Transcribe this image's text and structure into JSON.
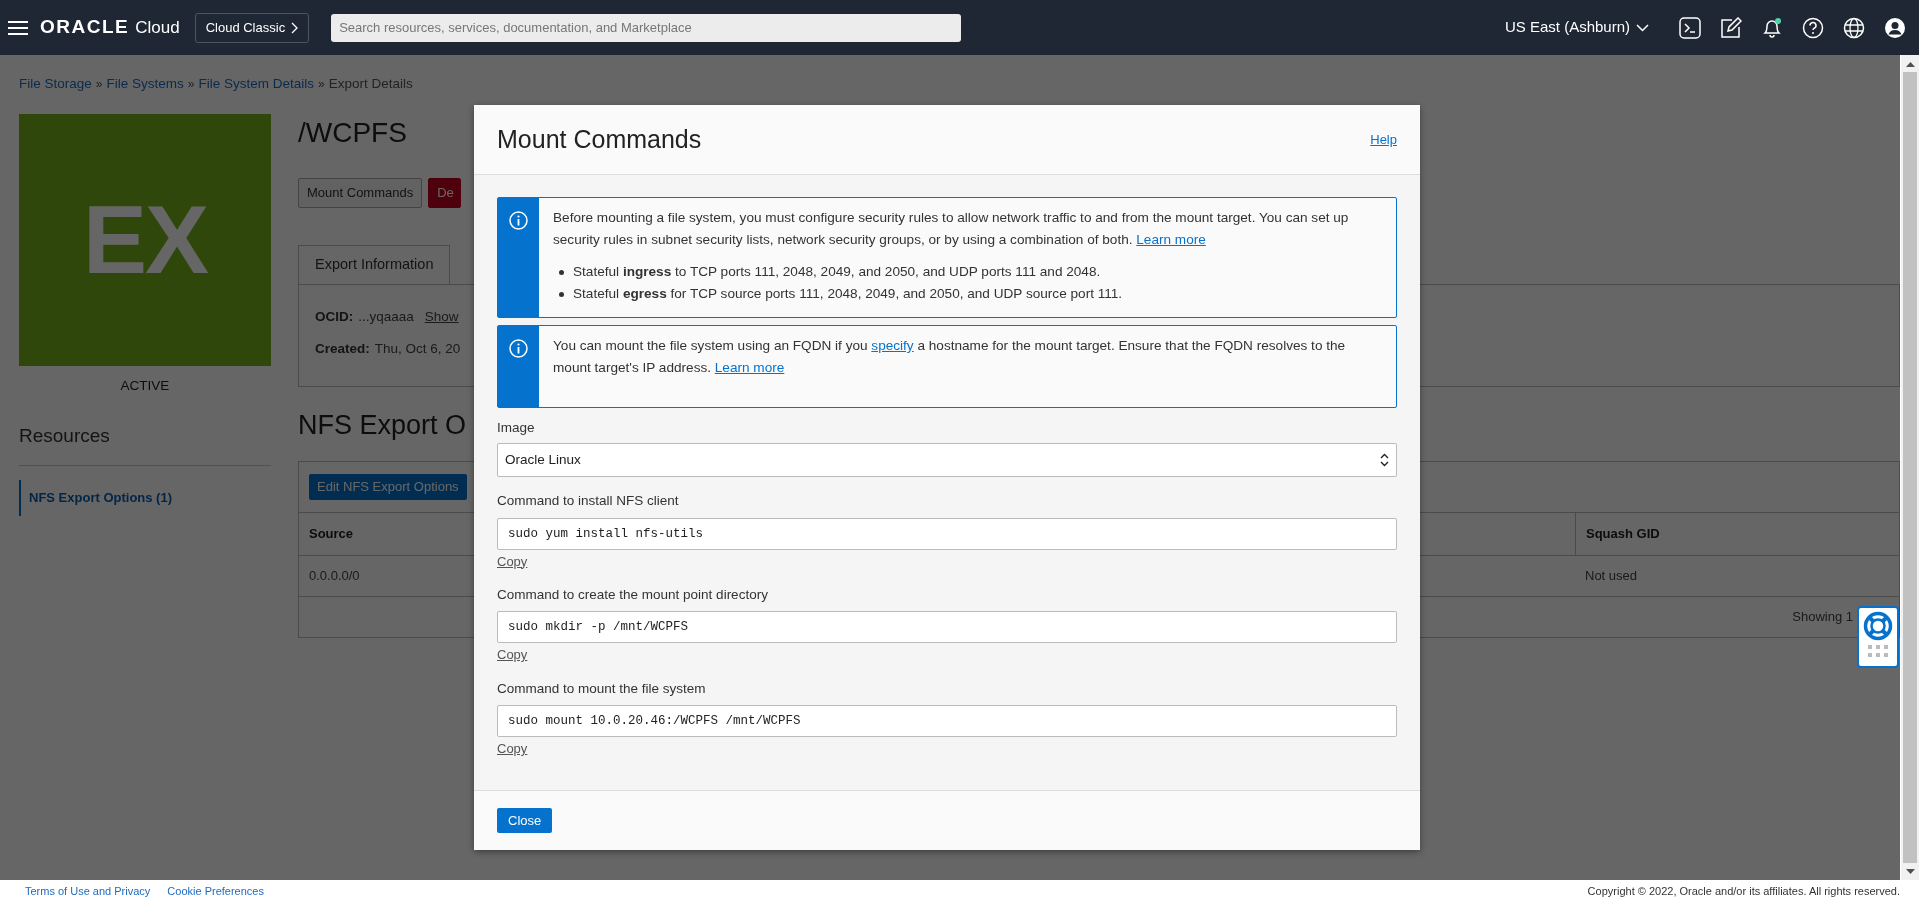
{
  "top_bar": {
    "wordmark": "ORACLE",
    "product": "Cloud",
    "console_button": "Cloud Classic",
    "search": {
      "placeholder": "Search resources, services, documentation, and Marketplace"
    },
    "region": "US East (Ashburn)"
  },
  "breadcrumb": {
    "separator": "»",
    "items": [
      {
        "label": "File Storage",
        "current": false
      },
      {
        "label": "File Systems",
        "current": false
      },
      {
        "label": "File System Details",
        "current": false
      },
      {
        "label": "Export Details",
        "current": true
      }
    ]
  },
  "resource": {
    "badge": "EX",
    "state": "ACTIVE",
    "title": "/WCPFS",
    "buttons": [
      {
        "label": "Mount Commands",
        "kind": "default"
      },
      {
        "label": "De",
        "kind": "danger"
      }
    ]
  },
  "sidebar": {
    "title": "Resources",
    "items": [
      {
        "label": "NFS Export Options (1)",
        "selected": true
      }
    ]
  },
  "tabs": [
    {
      "label": "Export Information",
      "selected": true
    }
  ],
  "export_info": [
    {
      "label": "OCID:",
      "value": "...yqaaaa",
      "link": "Show"
    },
    {
      "label": "Created:",
      "value": "Thu, Oct 6, 20"
    }
  ],
  "section_title": "NFS Export O",
  "table": {
    "action": "Edit NFS Export Options",
    "columns": [
      "Source",
      "Squash GID"
    ],
    "rows": [
      [
        "0.0.0.0/0",
        "Not used"
      ]
    ],
    "footer": "Showing 1"
  },
  "modal": {
    "title": "Mount Commands",
    "help": "Help",
    "notices": [
      {
        "segments": [
          {
            "text": "Before mounting a file system, you must configure security rules to allow network traffic to and from the mount target. You can set up security rules in subnet security lists, network security groups, or by using a combination of both. ",
            "link": false
          },
          {
            "text": "Learn more",
            "link": true
          }
        ],
        "bullets": [
          "Stateful **ingress** to TCP ports 111, 2048, 2049, and 2050, and UDP ports 111 and 2048.",
          "Stateful **egress** for TCP source ports 111, 2048, 2049, and 2050, and UDP source port 111."
        ]
      },
      {
        "segments": [
          {
            "text": "You can mount the file system using an FQDN if you ",
            "link": false
          },
          {
            "text": "specify",
            "link": true
          },
          {
            "text": " a hostname for the mount target. Ensure that the FQDN resolves to the mount target's IP address. ",
            "link": false
          },
          {
            "text": "Learn more",
            "link": true
          }
        ]
      }
    ],
    "image": {
      "label": "Image",
      "value": "Oracle Linux"
    },
    "commands": [
      {
        "label": "Command to install NFS client",
        "value": "sudo yum install nfs-utils",
        "copy": "Copy"
      },
      {
        "label": "Command to create the mount point directory",
        "value": "sudo mkdir -p /mnt/WCPFS",
        "copy": "Copy"
      },
      {
        "label": "Command to mount the file system",
        "value": "sudo mount 10.0.20.46:/WCPFS /mnt/WCPFS",
        "copy": "Copy"
      }
    ],
    "close": "Close"
  },
  "footer": {
    "links": [
      "Terms of Use and Privacy",
      "Cookie Preferences"
    ],
    "copyright": "Copyright © 2022, Oracle and/or its affiliates. All rights reserved."
  }
}
